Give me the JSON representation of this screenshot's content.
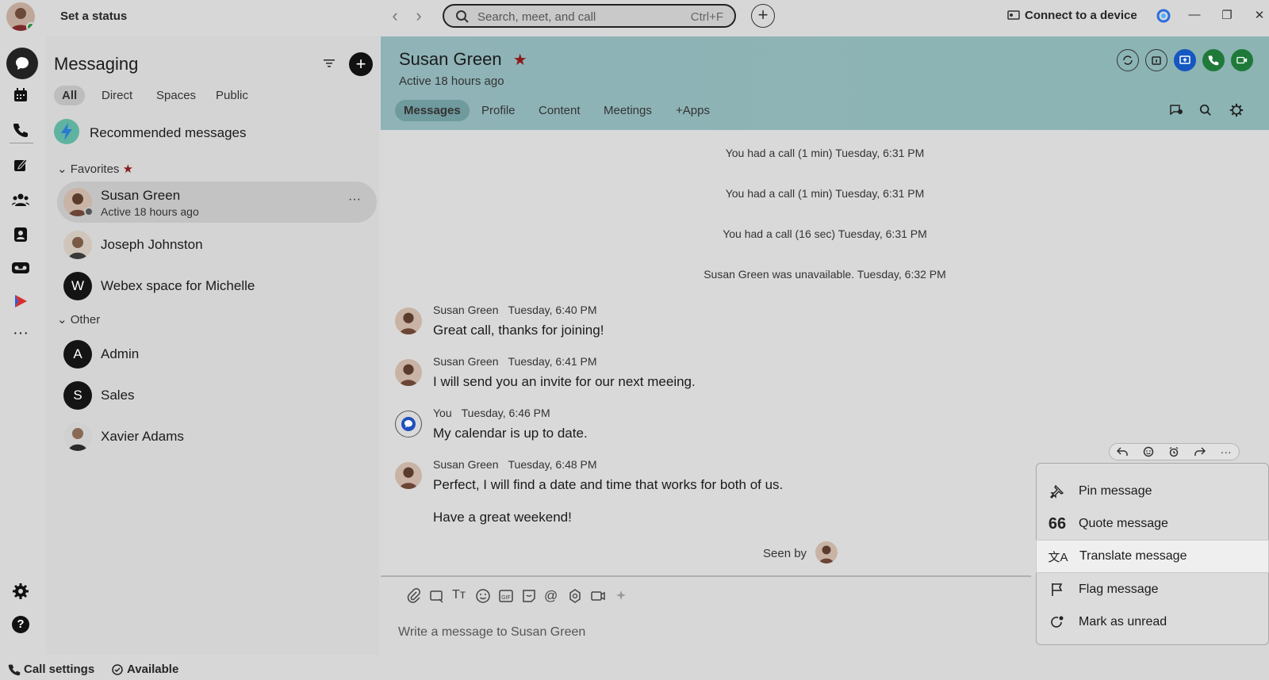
{
  "topbar": {
    "status": "Set a status",
    "search_placeholder": "Search, meet, and call",
    "search_shortcut": "Ctrl+F",
    "connect_device": "Connect to a device"
  },
  "messaging": {
    "title": "Messaging",
    "filters": [
      "All",
      "Direct",
      "Spaces",
      "Public"
    ],
    "recommended": "Recommended messages",
    "favorites_label": "Favorites",
    "other_label": "Other",
    "favorites": [
      {
        "name": "Susan Green",
        "status": "Active 18 hours ago"
      },
      {
        "name": "Joseph Johnston"
      },
      {
        "name": "Webex space for Michelle",
        "initial": "W"
      }
    ],
    "other": [
      {
        "name": "Admin",
        "initial": "A"
      },
      {
        "name": "Sales",
        "initial": "S"
      },
      {
        "name": "Xavier Adams"
      }
    ]
  },
  "chat": {
    "name": "Susan Green",
    "active": "Active 18 hours ago",
    "tabs": [
      "Messages",
      "Profile",
      "Content",
      "Meetings",
      "+Apps"
    ],
    "system_messages": [
      "You had a call (1 min) Tuesday, 6:31 PM",
      "You had a call (1 min) Tuesday, 6:31 PM",
      "You had a call (16 sec) Tuesday, 6:31 PM",
      "Susan Green was unavailable. Tuesday, 6:32 PM"
    ],
    "messages": [
      {
        "sender": "Susan Green",
        "time": "Tuesday, 6:40 PM",
        "text": "Great call, thanks for joining!"
      },
      {
        "sender": "Susan Green",
        "time": "Tuesday, 6:41 PM",
        "text": "I will send you an invite for our next meeing."
      },
      {
        "sender": "You",
        "time": "Tuesday, 6:46 PM",
        "text": "My calendar is up to date."
      },
      {
        "sender": "Susan Green",
        "time": "Tuesday, 6:48 PM",
        "text": "Perfect, I will find a date and time that works for both of us.",
        "text2": "Have a great weekend!"
      }
    ],
    "seen_by": "Seen by",
    "composer_placeholder": "Write a message to Susan Green"
  },
  "context_menu": [
    "Pin message",
    "Quote message",
    "Translate message",
    "Flag message",
    "Mark as unread"
  ],
  "bottombar": {
    "call_settings": "Call settings",
    "available": "Available"
  },
  "colors": {
    "header_bg": "#8fb3b7",
    "favorite_star": "#8b1a1a",
    "call_green": "#1f7a3a",
    "share_blue": "#1557c0"
  }
}
